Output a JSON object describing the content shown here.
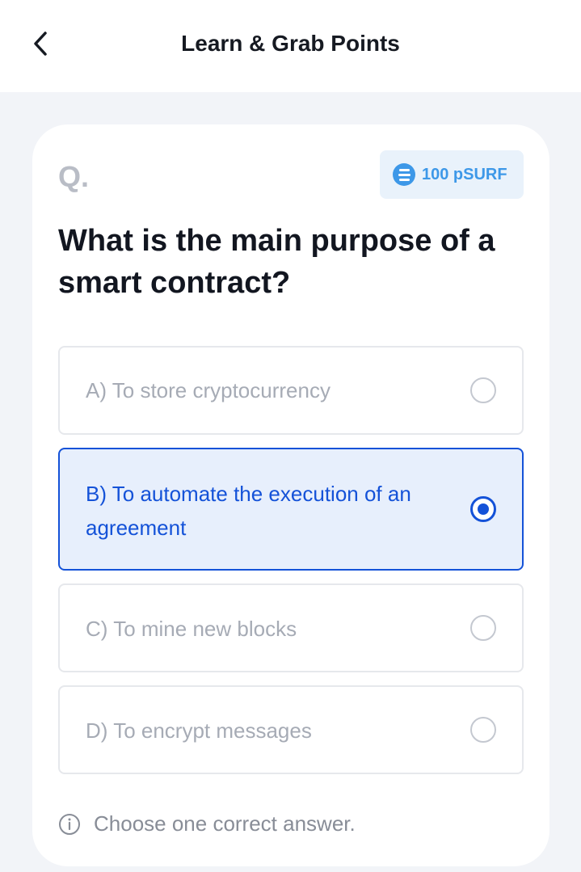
{
  "header": {
    "title": "Learn & Grab Points",
    "back_icon": "chevron-left-icon"
  },
  "quiz": {
    "q_marker": "Q.",
    "reward": {
      "label": "100 pSURF",
      "icon": "psurf-coin-icon"
    },
    "question": "What is the main purpose of a smart contract?",
    "options": [
      {
        "label": "A) To store cryptocurrency",
        "selected": false
      },
      {
        "label": "B) To automate the execution of an agreement",
        "selected": true
      },
      {
        "label": "C) To mine new blocks",
        "selected": false
      },
      {
        "label": "D) To encrypt messages",
        "selected": false
      }
    ],
    "hint": {
      "icon": "info-icon",
      "label": "Choose one correct answer."
    }
  },
  "colors": {
    "page_background": "#f2f4f8",
    "accent": "#1452d8",
    "selected_background": "#e7effc",
    "badge_background": "#e9f2fb",
    "badge_text": "#3d98e8",
    "muted_text": "#a6abb5"
  }
}
